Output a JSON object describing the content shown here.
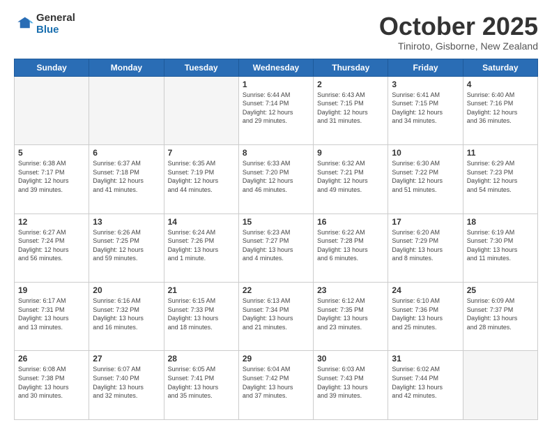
{
  "header": {
    "logo_general": "General",
    "logo_blue": "Blue",
    "month_title": "October 2025",
    "location": "Tiniroto, Gisborne, New Zealand"
  },
  "days_of_week": [
    "Sunday",
    "Monday",
    "Tuesday",
    "Wednesday",
    "Thursday",
    "Friday",
    "Saturday"
  ],
  "weeks": [
    [
      {
        "day": "",
        "info": ""
      },
      {
        "day": "",
        "info": ""
      },
      {
        "day": "",
        "info": ""
      },
      {
        "day": "1",
        "info": "Sunrise: 6:44 AM\nSunset: 7:14 PM\nDaylight: 12 hours\nand 29 minutes."
      },
      {
        "day": "2",
        "info": "Sunrise: 6:43 AM\nSunset: 7:15 PM\nDaylight: 12 hours\nand 31 minutes."
      },
      {
        "day": "3",
        "info": "Sunrise: 6:41 AM\nSunset: 7:15 PM\nDaylight: 12 hours\nand 34 minutes."
      },
      {
        "day": "4",
        "info": "Sunrise: 6:40 AM\nSunset: 7:16 PM\nDaylight: 12 hours\nand 36 minutes."
      }
    ],
    [
      {
        "day": "5",
        "info": "Sunrise: 6:38 AM\nSunset: 7:17 PM\nDaylight: 12 hours\nand 39 minutes."
      },
      {
        "day": "6",
        "info": "Sunrise: 6:37 AM\nSunset: 7:18 PM\nDaylight: 12 hours\nand 41 minutes."
      },
      {
        "day": "7",
        "info": "Sunrise: 6:35 AM\nSunset: 7:19 PM\nDaylight: 12 hours\nand 44 minutes."
      },
      {
        "day": "8",
        "info": "Sunrise: 6:33 AM\nSunset: 7:20 PM\nDaylight: 12 hours\nand 46 minutes."
      },
      {
        "day": "9",
        "info": "Sunrise: 6:32 AM\nSunset: 7:21 PM\nDaylight: 12 hours\nand 49 minutes."
      },
      {
        "day": "10",
        "info": "Sunrise: 6:30 AM\nSunset: 7:22 PM\nDaylight: 12 hours\nand 51 minutes."
      },
      {
        "day": "11",
        "info": "Sunrise: 6:29 AM\nSunset: 7:23 PM\nDaylight: 12 hours\nand 54 minutes."
      }
    ],
    [
      {
        "day": "12",
        "info": "Sunrise: 6:27 AM\nSunset: 7:24 PM\nDaylight: 12 hours\nand 56 minutes."
      },
      {
        "day": "13",
        "info": "Sunrise: 6:26 AM\nSunset: 7:25 PM\nDaylight: 12 hours\nand 59 minutes."
      },
      {
        "day": "14",
        "info": "Sunrise: 6:24 AM\nSunset: 7:26 PM\nDaylight: 13 hours\nand 1 minute."
      },
      {
        "day": "15",
        "info": "Sunrise: 6:23 AM\nSunset: 7:27 PM\nDaylight: 13 hours\nand 4 minutes."
      },
      {
        "day": "16",
        "info": "Sunrise: 6:22 AM\nSunset: 7:28 PM\nDaylight: 13 hours\nand 6 minutes."
      },
      {
        "day": "17",
        "info": "Sunrise: 6:20 AM\nSunset: 7:29 PM\nDaylight: 13 hours\nand 8 minutes."
      },
      {
        "day": "18",
        "info": "Sunrise: 6:19 AM\nSunset: 7:30 PM\nDaylight: 13 hours\nand 11 minutes."
      }
    ],
    [
      {
        "day": "19",
        "info": "Sunrise: 6:17 AM\nSunset: 7:31 PM\nDaylight: 13 hours\nand 13 minutes."
      },
      {
        "day": "20",
        "info": "Sunrise: 6:16 AM\nSunset: 7:32 PM\nDaylight: 13 hours\nand 16 minutes."
      },
      {
        "day": "21",
        "info": "Sunrise: 6:15 AM\nSunset: 7:33 PM\nDaylight: 13 hours\nand 18 minutes."
      },
      {
        "day": "22",
        "info": "Sunrise: 6:13 AM\nSunset: 7:34 PM\nDaylight: 13 hours\nand 21 minutes."
      },
      {
        "day": "23",
        "info": "Sunrise: 6:12 AM\nSunset: 7:35 PM\nDaylight: 13 hours\nand 23 minutes."
      },
      {
        "day": "24",
        "info": "Sunrise: 6:10 AM\nSunset: 7:36 PM\nDaylight: 13 hours\nand 25 minutes."
      },
      {
        "day": "25",
        "info": "Sunrise: 6:09 AM\nSunset: 7:37 PM\nDaylight: 13 hours\nand 28 minutes."
      }
    ],
    [
      {
        "day": "26",
        "info": "Sunrise: 6:08 AM\nSunset: 7:38 PM\nDaylight: 13 hours\nand 30 minutes."
      },
      {
        "day": "27",
        "info": "Sunrise: 6:07 AM\nSunset: 7:40 PM\nDaylight: 13 hours\nand 32 minutes."
      },
      {
        "day": "28",
        "info": "Sunrise: 6:05 AM\nSunset: 7:41 PM\nDaylight: 13 hours\nand 35 minutes."
      },
      {
        "day": "29",
        "info": "Sunrise: 6:04 AM\nSunset: 7:42 PM\nDaylight: 13 hours\nand 37 minutes."
      },
      {
        "day": "30",
        "info": "Sunrise: 6:03 AM\nSunset: 7:43 PM\nDaylight: 13 hours\nand 39 minutes."
      },
      {
        "day": "31",
        "info": "Sunrise: 6:02 AM\nSunset: 7:44 PM\nDaylight: 13 hours\nand 42 minutes."
      },
      {
        "day": "",
        "info": ""
      }
    ]
  ]
}
